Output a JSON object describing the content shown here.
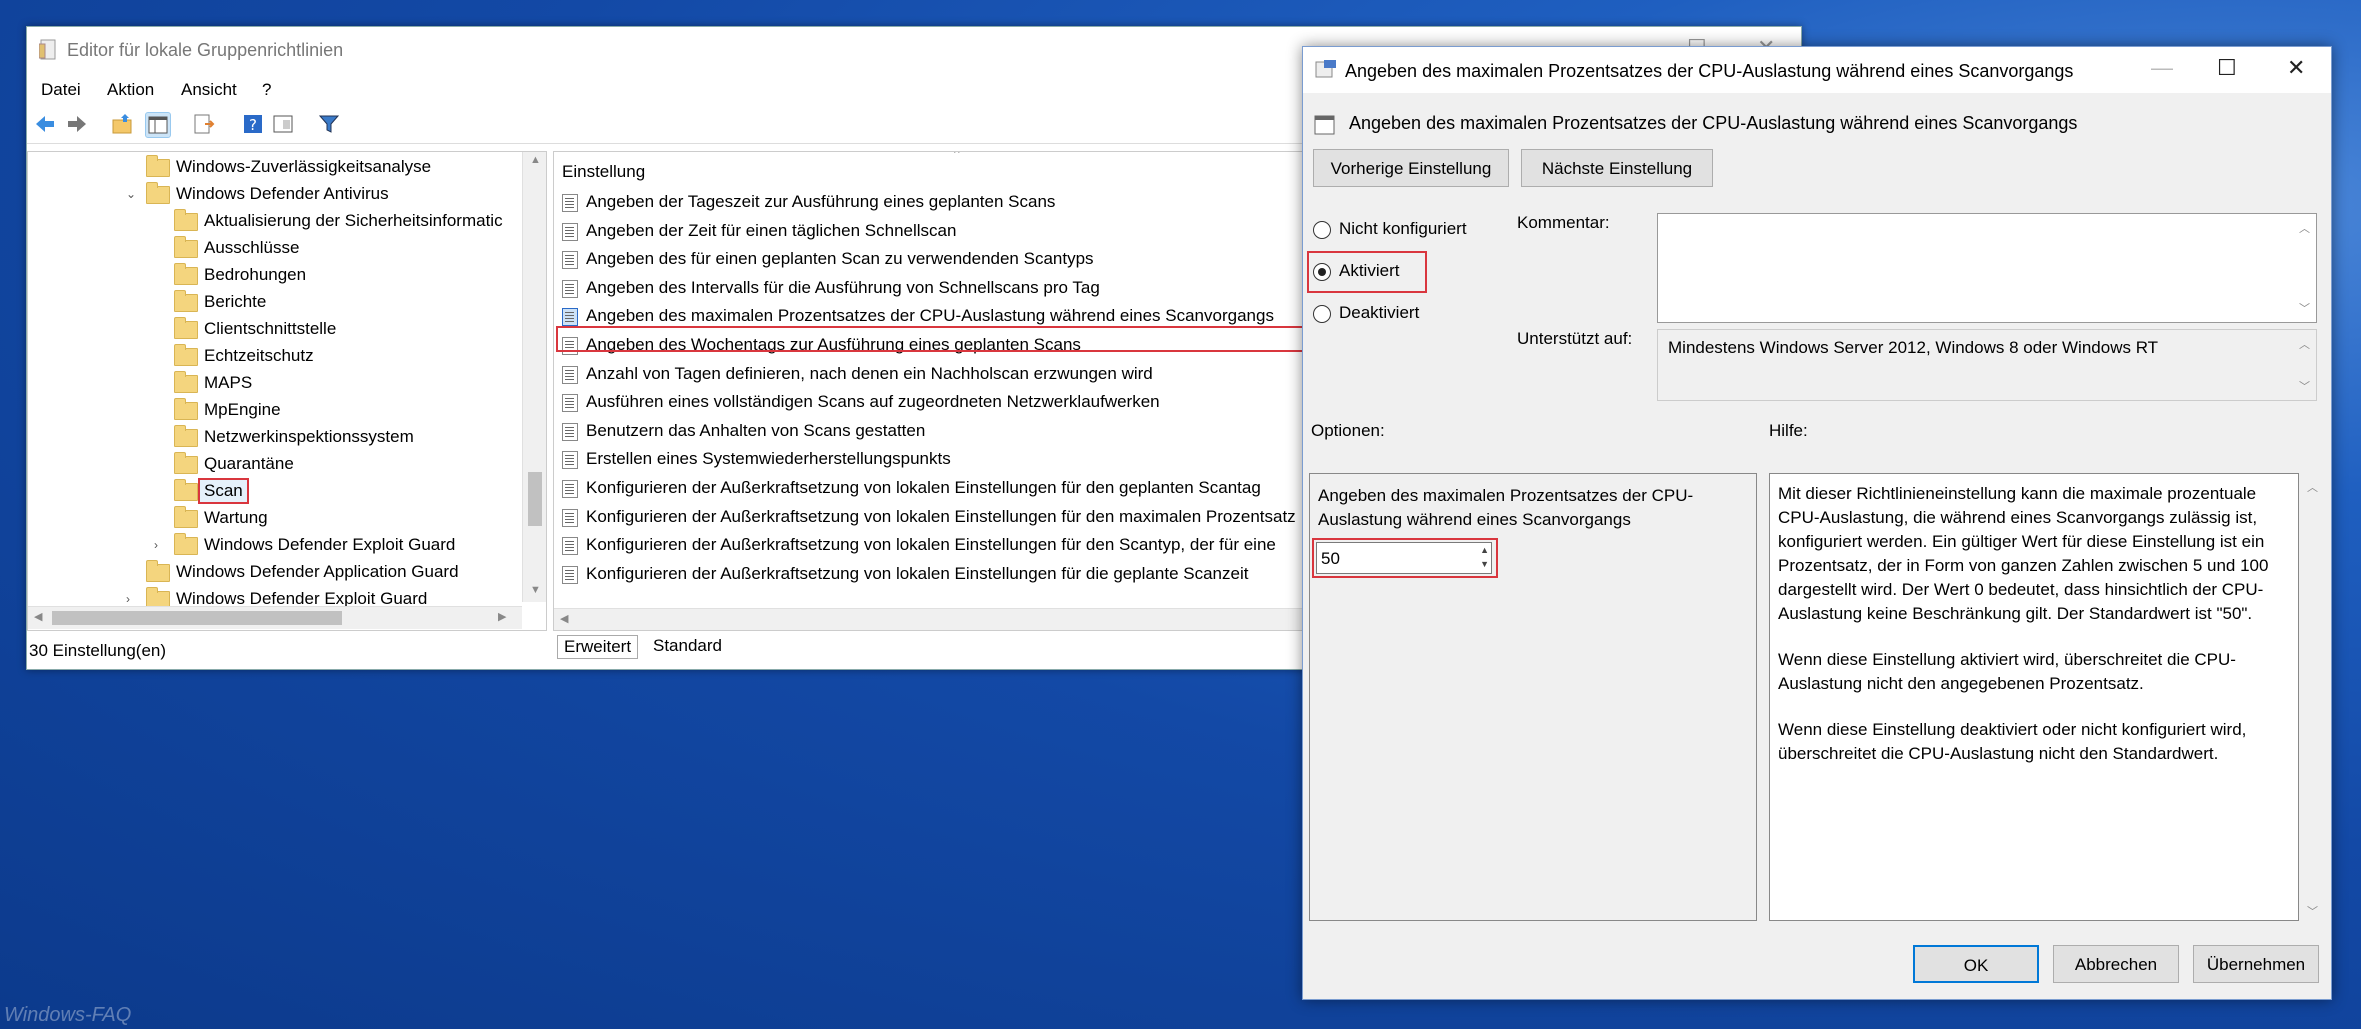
{
  "editor": {
    "title": "Editor für lokale Gruppenrichtlinien",
    "menu": [
      "Datei",
      "Aktion",
      "Ansicht",
      "?"
    ],
    "tree": [
      {
        "label": "Windows-Zuverlässigkeitsanalyse",
        "level": 0
      },
      {
        "label": "Windows Defender Antivirus",
        "level": 0,
        "expanded": true
      },
      {
        "label": "Aktualisierung der Sicherheitsinformatic",
        "level": 1
      },
      {
        "label": "Ausschlüsse",
        "level": 1
      },
      {
        "label": "Bedrohungen",
        "level": 1
      },
      {
        "label": "Berichte",
        "level": 1
      },
      {
        "label": "Clientschnittstelle",
        "level": 1
      },
      {
        "label": "Echtzeitschutz",
        "level": 1
      },
      {
        "label": "MAPS",
        "level": 1
      },
      {
        "label": "MpEngine",
        "level": 1
      },
      {
        "label": "Netzwerkinspektionssystem",
        "level": 1
      },
      {
        "label": "Quarantäne",
        "level": 1
      },
      {
        "label": "Scan",
        "level": 1,
        "selected": true
      },
      {
        "label": "Wartung",
        "level": 1
      },
      {
        "label": "Windows Defender Exploit Guard",
        "level": 1,
        "collapsed": true
      },
      {
        "label": "Windows Defender Application Guard",
        "level": 0
      },
      {
        "label": "Windows Defender Exploit Guard",
        "level": 0,
        "collapsed": true
      }
    ],
    "list_header": "Einstellung",
    "list": [
      "Angeben der Tageszeit zur Ausführung eines geplanten Scans",
      "Angeben der Zeit für einen täglichen Schnellscan",
      "Angeben des für einen geplanten Scan zu verwendenden Scantyps",
      "Angeben des Intervalls für die Ausführung von Schnellscans pro Tag",
      "Angeben des maximalen Prozentsatzes der CPU-Auslastung während eines Scanvorgangs",
      "Angeben des Wochentags zur Ausführung eines geplanten Scans",
      "Anzahl von Tagen definieren, nach denen ein Nachholscan erzwungen wird",
      "Ausführen eines vollständigen Scans auf zugeordneten Netzwerklaufwerken",
      "Benutzern das Anhalten von Scans gestatten",
      "Erstellen eines Systemwiederherstellungspunkts",
      "Konfigurieren der Außerkraftsetzung von lokalen Einstellungen für den geplanten Scantag",
      "Konfigurieren der Außerkraftsetzung von lokalen Einstellungen für den maximalen Prozentsatz",
      "Konfigurieren der Außerkraftsetzung von lokalen Einstellungen für den Scantyp, der für eine",
      "Konfigurieren der Außerkraftsetzung von lokalen Einstellungen für die geplante Scanzeit"
    ],
    "tabs": [
      "Erweitert",
      "Standard"
    ],
    "status": "30 Einstellung(en)"
  },
  "dialog": {
    "title": "Angeben des maximalen Prozentsatzes der CPU-Auslastung während eines Scanvorgangs",
    "heading": "Angeben des maximalen Prozentsatzes der CPU-Auslastung während eines Scanvorgangs",
    "prev_btn": "Vorherige Einstellung",
    "next_btn": "Nächste Einstellung",
    "radio_not_configured": "Nicht konfiguriert",
    "radio_enabled": "Aktiviert",
    "radio_disabled": "Deaktiviert",
    "comment_label": "Kommentar:",
    "supported_label": "Unterstützt auf:",
    "supported_value": "Mindestens Windows Server 2012, Windows 8 oder Windows RT",
    "options_label": "Optionen:",
    "help_label": "Hilfe:",
    "option_desc": "Angeben des maximalen Prozentsatzes der CPU-Auslastung während eines Scanvorgangs",
    "option_value": "50",
    "help_p1": "Mit dieser Richtlinieneinstellung kann die maximale prozentuale CPU-Auslastung, die während eines Scanvorgangs zulässig ist, konfiguriert werden. Ein gültiger Wert für diese Einstellung ist ein Prozentsatz, der in Form von ganzen Zahlen zwischen 5 und 100 dargestellt wird. Der Wert 0 bedeutet, dass hinsichtlich der CPU-Auslastung keine Beschränkung gilt. Der Standardwert ist \"50\".",
    "help_p2": "Wenn diese Einstellung aktiviert wird, überschreitet die CPU-Auslastung nicht den angegebenen Prozentsatz.",
    "help_p3": "Wenn diese Einstellung deaktiviert oder nicht konfiguriert wird, überschreitet die CPU-Auslastung nicht den Standardwert.",
    "ok": "OK",
    "cancel": "Abbrechen",
    "apply": "Übernehmen"
  },
  "watermark": "Windows-FAQ",
  "colors": {
    "highlight": "#d9363e",
    "accent": "#0078d7",
    "desktop": "#1349a6"
  }
}
